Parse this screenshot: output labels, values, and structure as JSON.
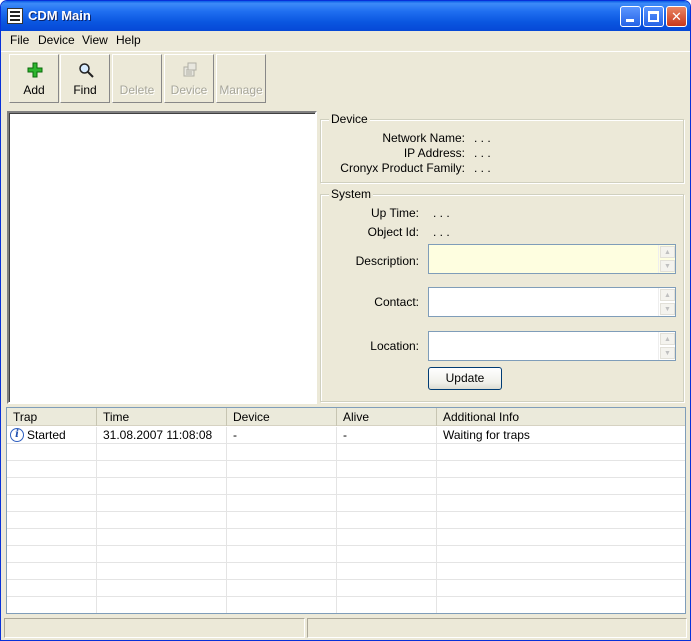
{
  "window": {
    "title": "CDM Main"
  },
  "menu": [
    "File",
    "Device",
    "View",
    "Help"
  ],
  "toolbar": {
    "add": "Add",
    "find": "Find",
    "delete": "Delete",
    "device": "Device",
    "manage": "Manage"
  },
  "device_group": {
    "title": "Device",
    "network_name_label": "Network Name:",
    "network_name_value": ". . .",
    "ip_address_label": "IP Address:",
    "ip_address_value": ". . .",
    "product_family_label": "Cronyx Product Family:",
    "product_family_value": ". . ."
  },
  "system_group": {
    "title": "System",
    "uptime_label": "Up Time:",
    "uptime_value": ". . .",
    "object_id_label": "Object Id:",
    "object_id_value": ". . .",
    "description_label": "Description:",
    "contact_label": "Contact:",
    "location_label": "Location:",
    "update_button": "Update"
  },
  "traps": {
    "columns": [
      "Trap",
      "Time",
      "Device",
      "Alive",
      "Additional Info"
    ],
    "rows": [
      {
        "trap": "Started",
        "time": "31.08.2007 11:08:08",
        "device": "-",
        "alive": "-",
        "info": "Waiting for traps"
      }
    ]
  },
  "colors": {
    "titlebar": "#0a56e0",
    "window_bg": "#ece9d8",
    "description_bg": "#fefee0"
  },
  "icons": {
    "add": "green-plus-icon",
    "find": "magnifier-icon",
    "device": "device-icon",
    "trap_started": "info-icon"
  }
}
